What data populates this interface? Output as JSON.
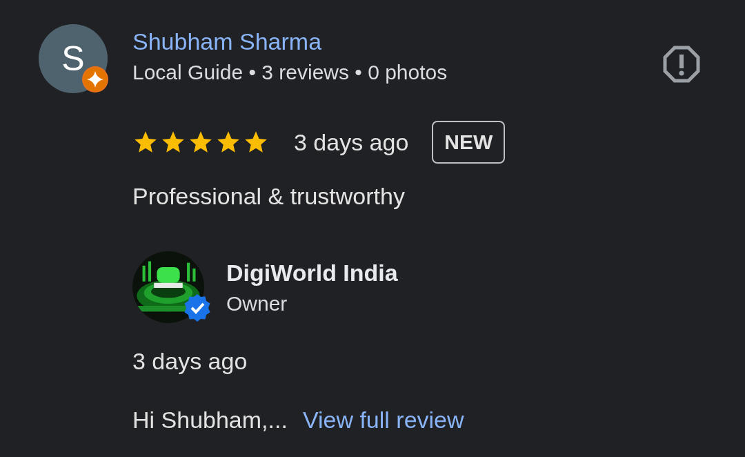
{
  "reviewer": {
    "avatar_letter": "S",
    "name": "Shubham Sharma",
    "meta": "Local Guide • 3 reviews • 0 photos"
  },
  "review": {
    "stars": 5,
    "time": "3 days ago",
    "badge": "NEW",
    "text": "Professional & trustworthy"
  },
  "owner_reply": {
    "name": "DigiWorld India",
    "role": "Owner",
    "time": "3 days ago",
    "excerpt": "Hi Shubham,...",
    "link": "View full review"
  }
}
